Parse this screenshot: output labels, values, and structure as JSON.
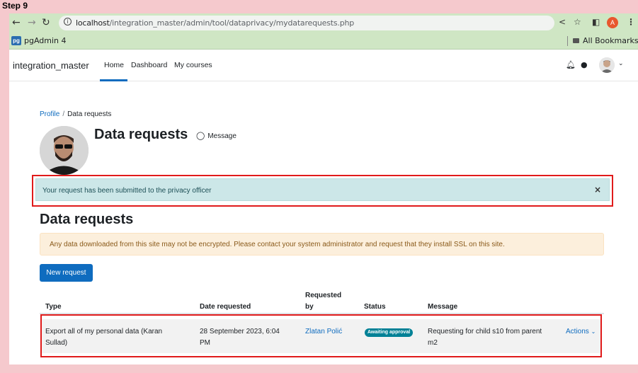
{
  "step_label": "Step 9",
  "browser": {
    "back_icon": "arrow-left-icon",
    "forward_icon": "arrow-right-icon",
    "reload_icon": "reload-icon",
    "url_host": "localhost",
    "url_path": "/integration_master/admin/tool/dataprivacy/mydatarequests.php",
    "profile_letter": "A",
    "bookmark_pg_logo": "pg",
    "bookmark_pgadmin": "pgAdmin 4",
    "all_bookmarks": "All Bookmarks"
  },
  "navbar": {
    "brand": "integration_master",
    "items": [
      "Home",
      "Dashboard",
      "My courses"
    ],
    "active_color": "#0f6cbf"
  },
  "breadcrumb": {
    "profile": "Profile",
    "separator": "/",
    "current": "Data requests"
  },
  "header": {
    "title": "Data requests",
    "message_link": "Message"
  },
  "alert": {
    "text": "Your request has been submitted to the privacy officer",
    "close": "×"
  },
  "section": {
    "title": "Data requests",
    "warning": "Any data downloaded from this site may not be encrypted. Please contact your system administrator and request that they install SSL on this site.",
    "new_request_button": "New request"
  },
  "table": {
    "headers": {
      "type": "Type",
      "date": "Date requested",
      "requested_by_1": "Requested",
      "requested_by_2": "by",
      "status": "Status",
      "message": "Message"
    },
    "rows": [
      {
        "type_1": "Export all of my personal data (Karan",
        "type_2": "Sullad)",
        "date_1": "28 September 2023, 6:04",
        "date_2": "PM",
        "requested_by": "Zlatan Polić",
        "status": "Awaiting approval",
        "message_1": "Requesting for child s10 from parent",
        "message_2": "m2",
        "actions": "Actions"
      }
    ]
  },
  "colors": {
    "highlight_outline": "#e01b1b",
    "status_badge": "#008196",
    "primary": "#0f6cbf"
  }
}
